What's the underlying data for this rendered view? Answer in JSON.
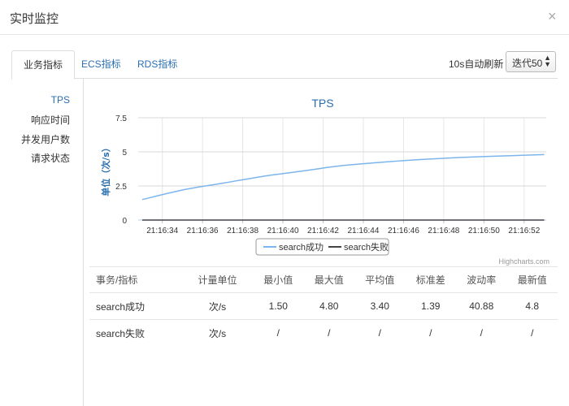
{
  "dialog": {
    "title": "实时监控",
    "close": "×"
  },
  "tabs": [
    "业务指标",
    "ECS指标",
    "RDS指标"
  ],
  "toolbar": {
    "refresh_label": "10s自动刷新",
    "iteration_selected": "迭代50"
  },
  "sidebar": {
    "items": [
      "TPS",
      "响应时间",
      "并发用户数",
      "请求状态"
    ]
  },
  "credits": "Highcharts.com",
  "chart_data": {
    "type": "line",
    "title": "TPS",
    "ylabel": "单位（次/s）",
    "ylim": [
      0,
      7.5
    ],
    "yticks": [
      "0",
      "2.5",
      "5",
      "7.5"
    ],
    "xticks": [
      "21:16:34",
      "21:16:36",
      "21:16:38",
      "21:16:40",
      "21:16:42",
      "21:16:44",
      "21:16:46",
      "21:16:48",
      "21:16:50",
      "21:16:52"
    ],
    "legend_position": "bottom",
    "series": [
      {
        "name": "search成功",
        "color": "#7cb5ec",
        "x": [
          "21:16:33",
          "21:16:35",
          "21:16:37",
          "21:16:39",
          "21:16:41",
          "21:16:43",
          "21:16:45",
          "21:16:47",
          "21:16:49",
          "21:16:51",
          "21:16:53"
        ],
        "values": [
          1.5,
          2.2,
          2.7,
          3.2,
          3.6,
          4.0,
          4.25,
          4.45,
          4.6,
          4.7,
          4.8
        ]
      },
      {
        "name": "search失败",
        "color": "#434348",
        "x": [
          "21:16:33",
          "21:16:53"
        ],
        "values": [
          0,
          0
        ]
      }
    ]
  },
  "table": {
    "headers": [
      "事务/指标",
      "计量单位",
      "最小值",
      "最大值",
      "平均值",
      "标准差",
      "波动率",
      "最新值"
    ],
    "rows": [
      [
        "search成功",
        "次/s",
        "1.50",
        "4.80",
        "3.40",
        "1.39",
        "40.88",
        "4.8"
      ],
      [
        "search失败",
        "次/s",
        "/",
        "/",
        "/",
        "/",
        "/",
        "/"
      ]
    ]
  }
}
